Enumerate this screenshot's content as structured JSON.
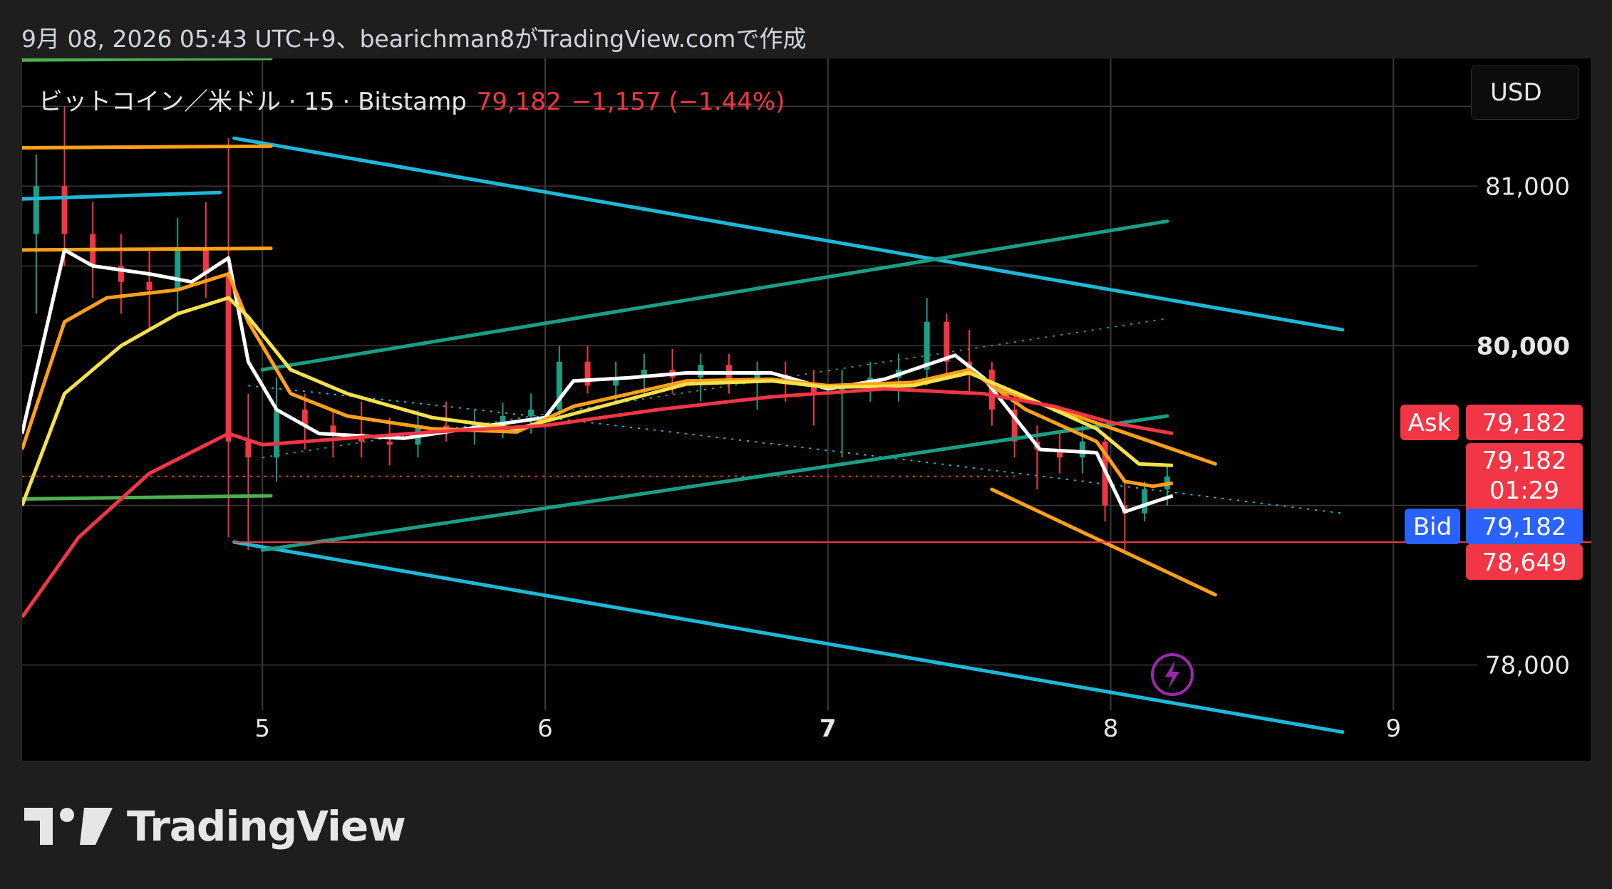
{
  "caption": "9月 08, 2026 05:43 UTC+9、bearichman8がTradingView.comで作成",
  "legend": {
    "symbol": "ビットコイン／米ドル · 15 · Bitstamp",
    "price": "79,182",
    "change": "−1,157 (−1.44%)"
  },
  "currency_button": "USD",
  "brand": {
    "name": "TradingView",
    "logo_icon": "tradingview-logo-icon"
  },
  "colors": {
    "background": "#000000",
    "grid": "#3a3a3a",
    "axis_text": "#e6e6e6",
    "down": "#f23645",
    "bid": "#2962ff",
    "cyan": "#1eb8d6",
    "teal": "#1a9e86",
    "orange": "#ff9f1a",
    "green": "#4caf50",
    "yellow": "#f5e14b",
    "white": "#ffffff"
  },
  "chart_data": {
    "type": "line",
    "instrument": "ビットコイン／米ドル",
    "interval": "15",
    "exchange": "Bitstamp",
    "x_ticks": [
      "5",
      "6",
      "7",
      "8",
      "9"
    ],
    "y_ticks": [
      "78,000",
      "80,000",
      "81,000"
    ],
    "y_range": [
      77400,
      81800
    ],
    "x_range": [
      4.15,
      9.7
    ],
    "price_labels": {
      "ask_label": "Ask",
      "ask": "79,182",
      "last": "79,182",
      "countdown": "01:29",
      "bid_label": "Bid",
      "bid": "79,182",
      "low": "78,649"
    },
    "series": [
      {
        "name": "",
        "color": "#ffffff",
        "points": [
          [
            4.15,
            79450
          ],
          [
            4.3,
            80600
          ],
          [
            4.4,
            80500
          ],
          [
            4.6,
            80450
          ],
          [
            4.75,
            80400
          ],
          [
            4.88,
            80550
          ],
          [
            4.95,
            79900
          ],
          [
            5.05,
            79600
          ],
          [
            5.2,
            79450
          ],
          [
            5.5,
            79420
          ],
          [
            5.8,
            79500
          ],
          [
            6.0,
            79550
          ],
          [
            6.1,
            79780
          ],
          [
            6.3,
            79800
          ],
          [
            6.5,
            79830
          ],
          [
            6.8,
            79830
          ],
          [
            7.0,
            79730
          ],
          [
            7.2,
            79790
          ],
          [
            7.35,
            79880
          ],
          [
            7.45,
            79940
          ],
          [
            7.55,
            79800
          ],
          [
            7.75,
            79350
          ],
          [
            7.95,
            79330
          ],
          [
            8.05,
            78960
          ],
          [
            8.15,
            79020
          ],
          [
            8.22,
            79060
          ]
        ]
      },
      {
        "name": "",
        "color": "#ff9f1a",
        "points": [
          [
            4.15,
            79350
          ],
          [
            4.3,
            80150
          ],
          [
            4.45,
            80300
          ],
          [
            4.7,
            80350
          ],
          [
            4.88,
            80450
          ],
          [
            4.95,
            80150
          ],
          [
            5.1,
            79700
          ],
          [
            5.3,
            79560
          ],
          [
            5.6,
            79480
          ],
          [
            5.9,
            79460
          ],
          [
            6.1,
            79620
          ],
          [
            6.5,
            79780
          ],
          [
            6.8,
            79790
          ],
          [
            7.0,
            79750
          ],
          [
            7.3,
            79770
          ],
          [
            7.5,
            79850
          ],
          [
            7.7,
            79600
          ],
          [
            7.95,
            79400
          ],
          [
            8.05,
            79150
          ],
          [
            8.15,
            79120
          ],
          [
            8.22,
            79140
          ]
        ]
      },
      {
        "name": "",
        "color": "#f5e14b",
        "points": [
          [
            4.15,
            79000
          ],
          [
            4.3,
            79700
          ],
          [
            4.5,
            80000
          ],
          [
            4.7,
            80200
          ],
          [
            4.88,
            80300
          ],
          [
            4.95,
            80180
          ],
          [
            5.1,
            79850
          ],
          [
            5.3,
            79700
          ],
          [
            5.6,
            79550
          ],
          [
            5.9,
            79480
          ],
          [
            6.2,
            79620
          ],
          [
            6.5,
            79760
          ],
          [
            6.8,
            79780
          ],
          [
            7.0,
            79740
          ],
          [
            7.3,
            79750
          ],
          [
            7.5,
            79830
          ],
          [
            7.7,
            79680
          ],
          [
            7.95,
            79480
          ],
          [
            8.1,
            79260
          ],
          [
            8.22,
            79250
          ]
        ]
      },
      {
        "name": "",
        "color": "#f23645",
        "points": [
          [
            4.15,
            78300
          ],
          [
            4.35,
            78800
          ],
          [
            4.6,
            79200
          ],
          [
            4.88,
            79450
          ],
          [
            5.0,
            79380
          ],
          [
            5.3,
            79420
          ],
          [
            5.6,
            79460
          ],
          [
            6.0,
            79500
          ],
          [
            6.4,
            79600
          ],
          [
            6.8,
            79680
          ],
          [
            7.2,
            79730
          ],
          [
            7.55,
            79700
          ],
          [
            7.8,
            79620
          ],
          [
            8.0,
            79520
          ],
          [
            8.22,
            79450
          ]
        ]
      }
    ],
    "trend_lines": [
      {
        "color": "#1eb8d6",
        "from": [
          4.15,
          80920
        ],
        "to": [
          4.85,
          80960
        ]
      },
      {
        "color": "#1eb8d6",
        "from": [
          4.9,
          81300
        ],
        "to": [
          8.82,
          80100
        ]
      },
      {
        "color": "#1eb8d6",
        "from": [
          4.9,
          78770
        ],
        "to": [
          8.82,
          77580
        ]
      },
      {
        "color": "#1a9e86",
        "from": [
          5.0,
          79850
        ],
        "to": [
          8.2,
          80780
        ]
      },
      {
        "color": "#1a9e86",
        "from": [
          5.0,
          78720
        ],
        "to": [
          8.2,
          79560
        ]
      },
      {
        "color": "#ff9f1a",
        "from": [
          4.15,
          81240
        ],
        "to": [
          5.03,
          81250
        ]
      },
      {
        "color": "#ff9f1a",
        "from": [
          4.15,
          80600
        ],
        "to": [
          5.03,
          80610
        ]
      },
      {
        "color": "#4caf50",
        "from": [
          4.15,
          79040
        ],
        "to": [
          5.03,
          79060
        ]
      },
      {
        "color": "#4caf50",
        "from": [
          4.15,
          81790
        ],
        "to": [
          5.03,
          81800
        ]
      },
      {
        "color": "#ff9f1a",
        "from": [
          7.6,
          79730
        ],
        "to": [
          8.37,
          79260
        ]
      },
      {
        "color": "#ff9f1a",
        "from": [
          7.58,
          79100
        ],
        "to": [
          8.37,
          78440
        ]
      },
      {
        "color": "#f23645",
        "from": [
          4.9,
          78770
        ],
        "to": [
          9.7,
          78770
        ]
      }
    ],
    "candles_approx": [
      [
        4.2,
        80700,
        81200,
        80200,
        81000
      ],
      [
        4.3,
        81000,
        81500,
        80500,
        80700
      ],
      [
        4.4,
        80700,
        80900,
        80300,
        80500
      ],
      [
        4.5,
        80500,
        80700,
        80200,
        80400
      ],
      [
        4.6,
        80400,
        80600,
        80100,
        80350
      ],
      [
        4.7,
        80350,
        80800,
        80200,
        80600
      ],
      [
        4.8,
        80600,
        80900,
        80300,
        80450
      ],
      [
        4.88,
        80450,
        81300,
        78800,
        79400
      ],
      [
        4.95,
        79400,
        79700,
        78720,
        79300
      ],
      [
        5.05,
        79300,
        79800,
        79150,
        79600
      ],
      [
        5.15,
        79600,
        79700,
        79350,
        79500
      ],
      [
        5.25,
        79500,
        79600,
        79300,
        79450
      ],
      [
        5.35,
        79450,
        79650,
        79300,
        79400
      ],
      [
        5.45,
        79400,
        79550,
        79250,
        79380
      ],
      [
        5.55,
        79380,
        79600,
        79300,
        79500
      ],
      [
        5.65,
        79500,
        79650,
        79400,
        79480
      ],
      [
        5.75,
        79480,
        79600,
        79380,
        79520
      ],
      [
        5.85,
        79520,
        79640,
        79420,
        79560
      ],
      [
        5.95,
        79560,
        79700,
        79450,
        79600
      ],
      [
        6.05,
        79600,
        80000,
        79550,
        79900
      ],
      [
        6.15,
        79900,
        80000,
        79700,
        79750
      ],
      [
        6.25,
        79750,
        79900,
        79650,
        79800
      ],
      [
        6.35,
        79800,
        79950,
        79700,
        79850
      ],
      [
        6.45,
        79850,
        79980,
        79700,
        79800
      ],
      [
        6.55,
        79800,
        79950,
        79650,
        79880
      ],
      [
        6.65,
        79880,
        79950,
        79700,
        79780
      ],
      [
        6.75,
        79780,
        79900,
        79600,
        79820
      ],
      [
        6.85,
        79820,
        79900,
        79650,
        79760
      ],
      [
        6.95,
        79760,
        79850,
        79500,
        79700
      ],
      [
        7.05,
        79700,
        79850,
        79300,
        79750
      ],
      [
        7.15,
        79750,
        79900,
        79650,
        79800
      ],
      [
        7.25,
        79800,
        79950,
        79650,
        79850
      ],
      [
        7.35,
        79850,
        80300,
        79750,
        80150
      ],
      [
        7.42,
        80150,
        80200,
        79800,
        79900
      ],
      [
        7.5,
        79900,
        80100,
        79700,
        79850
      ],
      [
        7.58,
        79850,
        79900,
        79500,
        79600
      ],
      [
        7.66,
        79600,
        79700,
        79300,
        79400
      ],
      [
        7.74,
        79400,
        79500,
        79100,
        79350
      ],
      [
        7.82,
        79350,
        79450,
        79200,
        79300
      ],
      [
        7.9,
        79300,
        79500,
        79200,
        79400
      ],
      [
        7.98,
        79400,
        79450,
        78900,
        79000
      ],
      [
        8.05,
        79000,
        79150,
        78700,
        78950
      ],
      [
        8.12,
        78950,
        79150,
        78900,
        79100
      ],
      [
        8.2,
        79100,
        79250,
        79000,
        79182
      ]
    ]
  }
}
